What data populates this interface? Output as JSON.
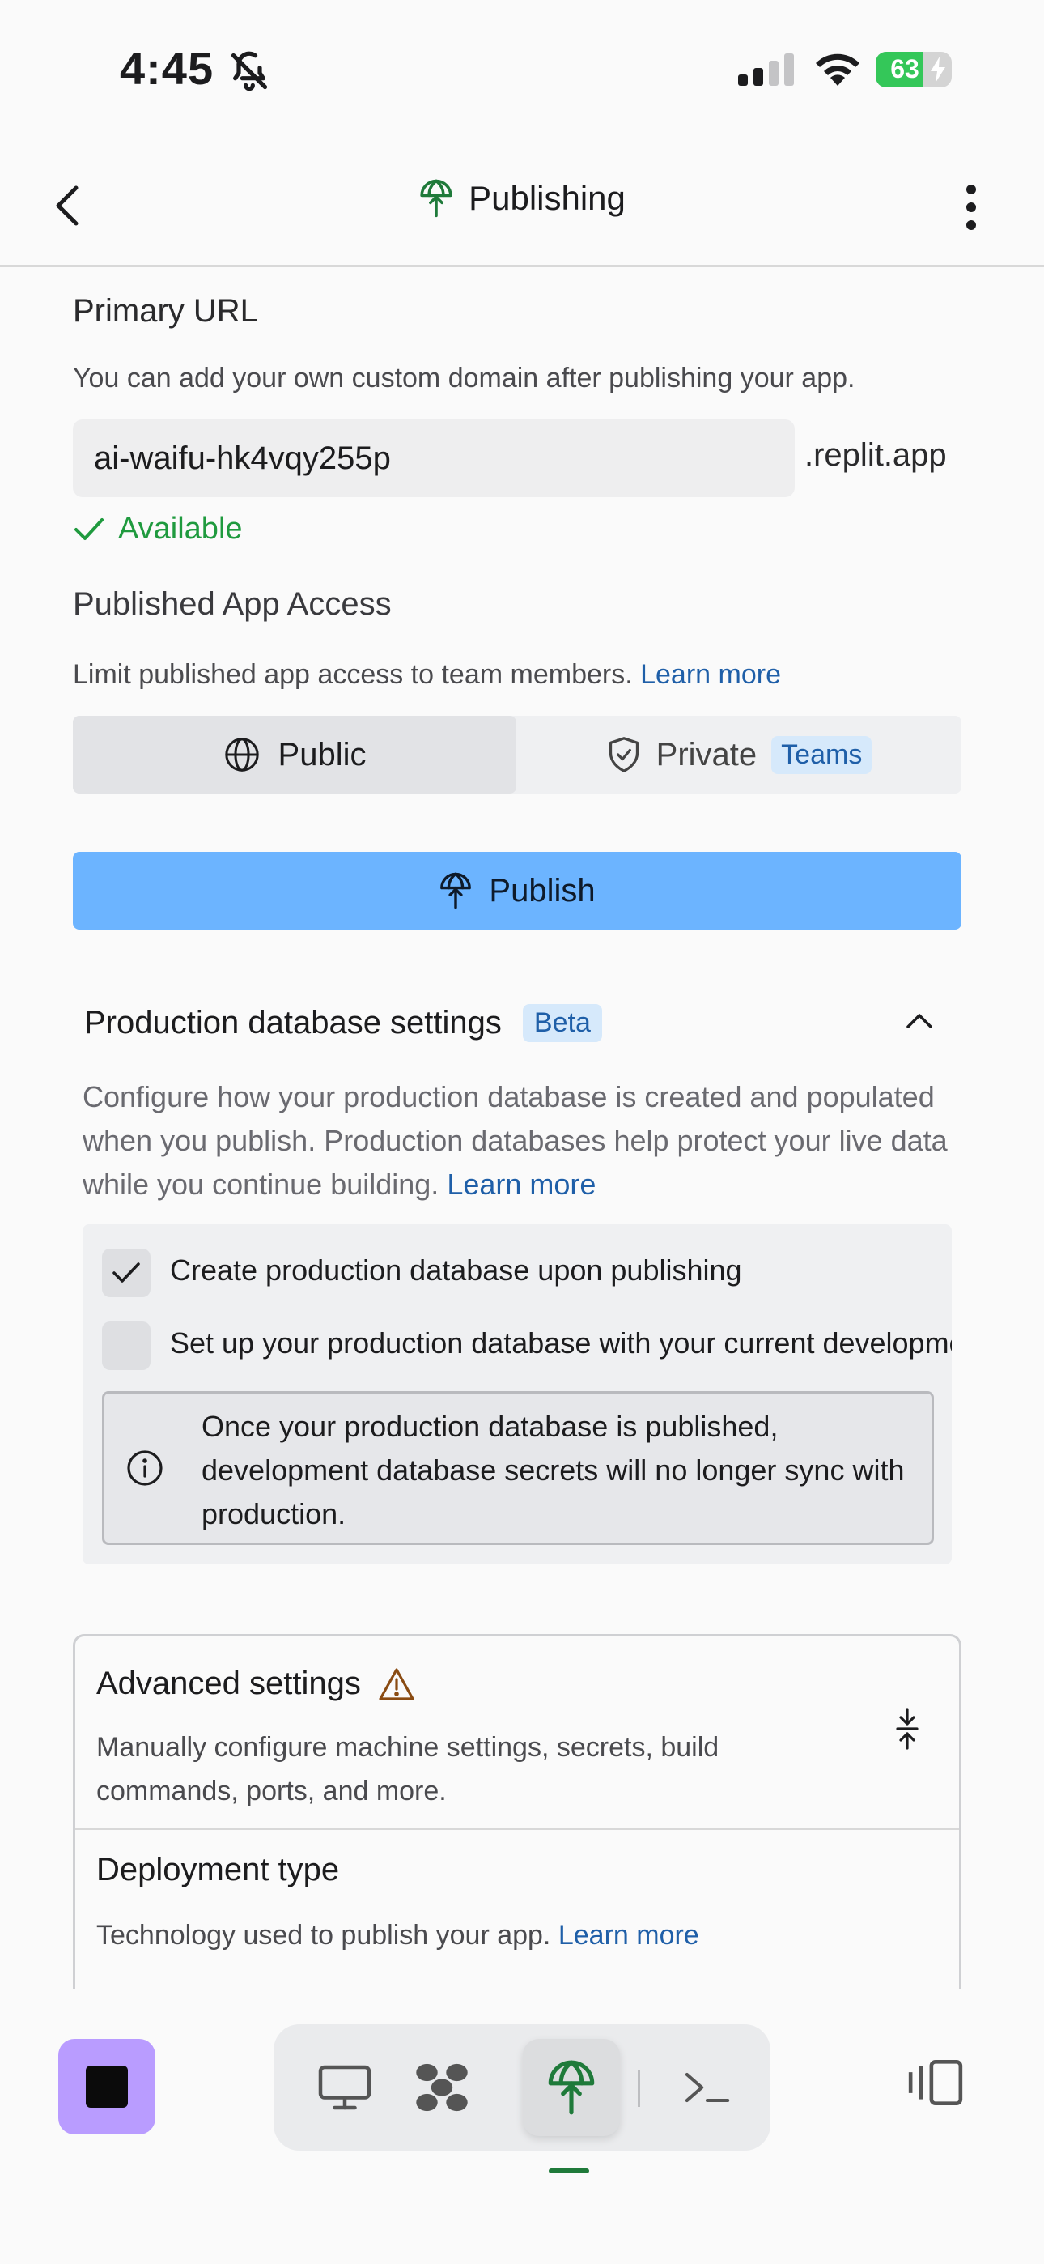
{
  "status_bar": {
    "time": "4:45",
    "battery": "63"
  },
  "header": {
    "title": "Publishing"
  },
  "primary_url": {
    "label": "Primary URL",
    "description": "You can add your own custom domain after publishing your app.",
    "value": "ai-waifu-hk4vqy255p",
    "suffix": ".replit.app",
    "status": "Available"
  },
  "access": {
    "label": "Published App Access",
    "description": "Limit published app access to team members.",
    "learn_more": "Learn more",
    "public_label": "Public",
    "private_label": "Private",
    "teams_badge": "Teams"
  },
  "publish_button": "Publish",
  "production_db": {
    "title": "Production database settings",
    "badge": "Beta",
    "description": "Configure how your production database is created and populated when you publish. Production databases help protect your live data while you continue building.",
    "learn_more": "Learn more",
    "option_create": "Create production database upon publishing",
    "option_create_checked": true,
    "option_setup": "Set up your production database with your current development data",
    "option_setup_checked": false,
    "info": "Once your production database is published, development database secrets will no longer sync with production."
  },
  "advanced": {
    "title": "Advanced settings",
    "description": "Manually configure machine settings, secrets, build commands, ports, and more."
  },
  "deployment": {
    "title": "Deployment type",
    "description": "Technology used to publish your app.",
    "learn_more": "Learn more"
  },
  "bottom_nav": {
    "items": [
      "preview-icon",
      "workflows-icon",
      "publishing-icon",
      "shell-icon"
    ],
    "active": "publishing-icon"
  },
  "colors": {
    "accent_green": "#1f7a3a",
    "publish_blue": "#6cb4ff",
    "link_blue": "#1f5fa8",
    "available_green": "#1f9a3e",
    "stop_purple": "#b99cff"
  }
}
